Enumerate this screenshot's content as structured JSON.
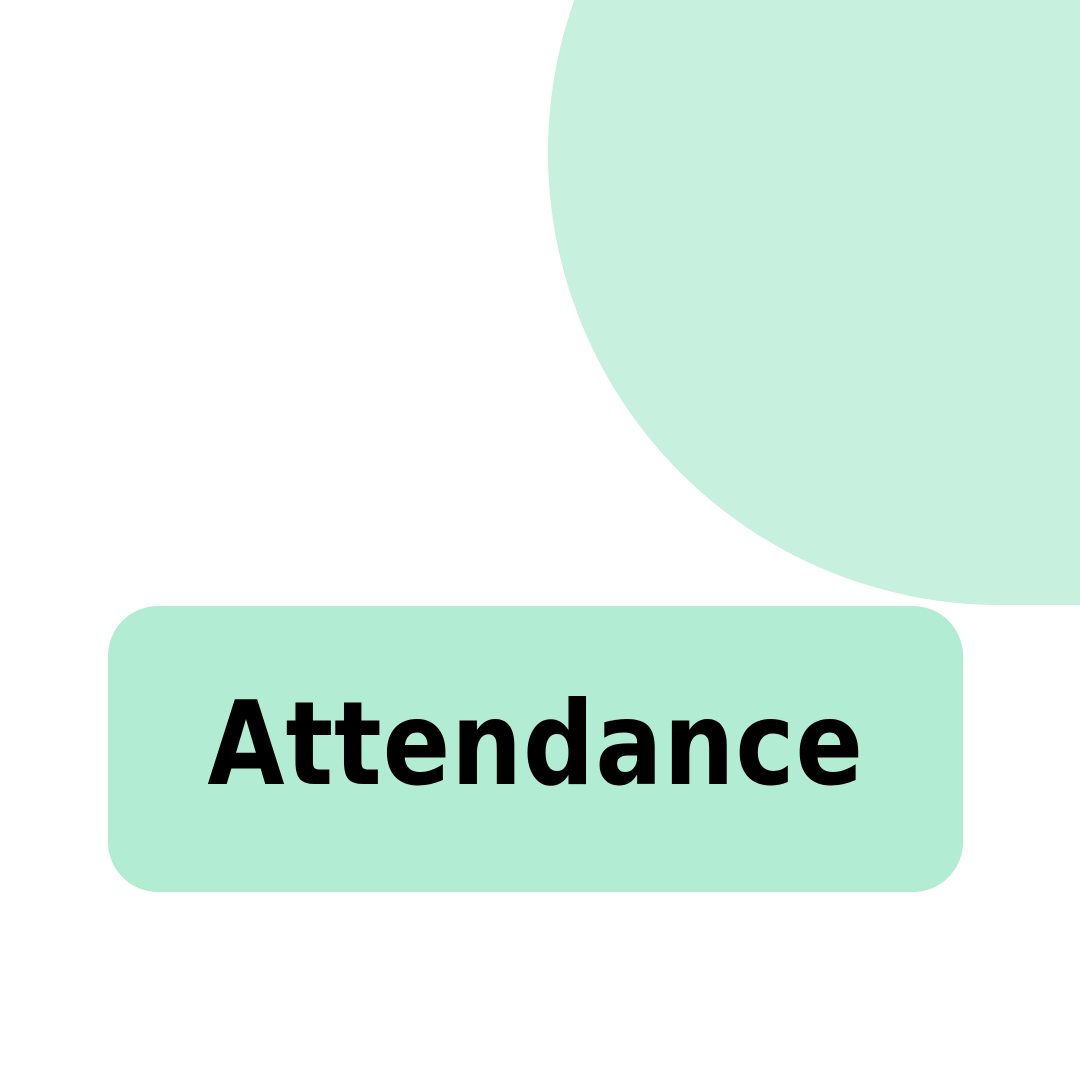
{
  "card": {
    "title": "Attendance"
  },
  "colors": {
    "background": "#ffffff",
    "blob": "#c7f0de",
    "card": "#b1ecd3",
    "text": "#000000"
  }
}
